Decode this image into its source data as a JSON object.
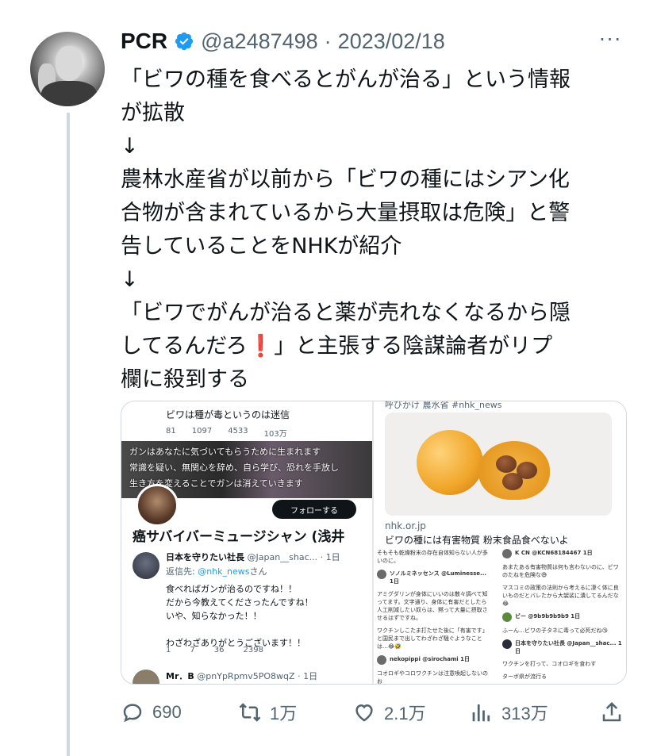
{
  "user": {
    "name": "PCR",
    "handle": "@a2487498",
    "separator": "·",
    "date": "2023/02/18"
  },
  "more_label": "···",
  "tweet_text": "「ビワの種を食べるとがんが治る」という情報\nが拡散\n↓\n農林水産省が以前から「ビワの種にはシアン化\n合物が含まれているから大量摂取は危険」と警\n告していることをNHKが紹介\n↓\n「ビワでがんが治ると薬が売れなくなるから隠\nしてるんだろ❗️」と主張する陰謀論者がリプ\n欄に殺到する",
  "media_left": {
    "reply_top": "ビワは種が毒というのは迷信",
    "stats_top": [
      "81",
      "1097",
      "4533",
      "103万"
    ],
    "banner_lines": [
      "ガンはあなたに気づいてもらうために生まれます",
      "常識を疑い、無関心を辞め、自ら学び、恐れを手放し",
      "生き方を変えることでガンは消えていきます"
    ],
    "follow_label": "フォローする",
    "profile_name": "癌サバイバーミュージシャン (浅井",
    "reply2": {
      "name": "日本を守りたい社長",
      "handle": "@Japan__shac...",
      "time": "1日",
      "to_prefix": "返信先: ",
      "to_handle": "@nhk_news",
      "to_suffix": "さん",
      "body": "食べればガンが治るのですね！！\nだから今教えてくださったんですね！\nいや、知らなかった！！\n\nわざわざありがとうございます！！",
      "stats": [
        "1",
        "7",
        "36",
        "2398"
      ]
    },
    "reply3": {
      "name": "Mr．B",
      "handle": "@pnYpRpmv5PO8wqZ",
      "time": "1日"
    }
  },
  "media_right": {
    "top_text": "呼びかけ 農水省 #nhk_news",
    "card_domain": "nhk.or.jp",
    "card_title": "ビワの種には有害物質 粉末食品食べないよ",
    "mini_left": [
      "そもそも乾燥粉末の存在自体知らない人が多いのに。",
      "ソノルミネッセンス @Luminesse... 1日",
      "アミグダリンが身体にいいのは散々調べて知ってます。文字通り、身体に有害だとしたら人工削減したい奴らは、黙って大量に摂取させるはずですね。",
      "ワクチンしこたま打たせた後に「有害です」と国民まで出してわざわざ騒ぐようなことは…😂🤣",
      "nekopippi @sirochami 1日",
      "コオロギやコロワクチンは注意喚起しないのお"
    ],
    "mini_right": [
      "K CN @KCN68184467 1日",
      "あまたある有害物質は何も言わないのに、ビワのたねを危険な😅",
      "マスコミの政策の法則から考えるに凄く体に良いものだとバレたから大袈裟に潰してるんだな😂",
      "ビー @9b9b9b9b9 1日",
      "ふーん…ビワの子タネに毒って必死だね😘",
      "日本を守りたい社長 @Japan__shac... 1日",
      "ワクチンを打って、コオロギを食わす",
      "ターボ県が流行る"
    ]
  },
  "actions": {
    "reply": "690",
    "retweet": "1万",
    "like": "2.1万",
    "views": "313万"
  },
  "colors": {
    "text": "#0f1419",
    "secondary": "#536471",
    "verified": "#1d9bf0",
    "border": "#cfd9de"
  }
}
